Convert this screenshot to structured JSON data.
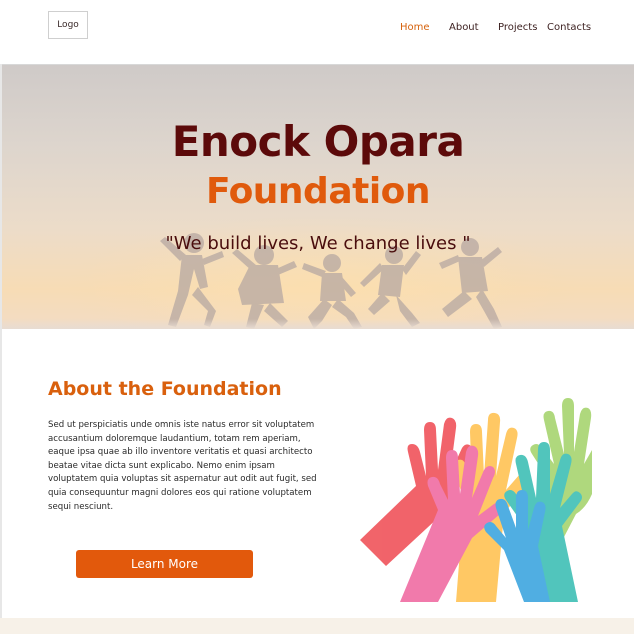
{
  "header": {
    "logo_label": "Logo",
    "nav": [
      {
        "label": "Home",
        "active": true
      },
      {
        "label": "About",
        "active": false
      },
      {
        "label": "Projects",
        "active": false
      },
      {
        "label": "Contacts",
        "active": false
      }
    ]
  },
  "hero": {
    "title_line1": "Enock Opara",
    "title_line2": "Foundation",
    "tagline": "\"We build lives, We change lives \""
  },
  "about": {
    "heading": "About the Foundation",
    "body": "Sed ut perspiciatis unde omnis iste natus error sit voluptatem accusantium doloremque laudantium, totam rem aperiam, eaque ipsa quae ab illo inventore veritatis et quasi architecto beatae vitae dicta sunt explicabo. Nemo enim ipsam voluptatem quia voluptas sit aspernatur aut odit aut fugit, sed quia consequuntur magni dolores eos qui ratione voluptatem sequi nesciunt.",
    "button_label": "Learn More"
  },
  "colors": {
    "brand_dark_red": "#5c0a0a",
    "brand_orange": "#e05a0c",
    "nav_active": "#d6620c",
    "footer_bg": "#f7f1e8"
  },
  "icons": {
    "hero_image": "jumping-people-silhouettes",
    "about_image": "raised-colorful-hands"
  }
}
